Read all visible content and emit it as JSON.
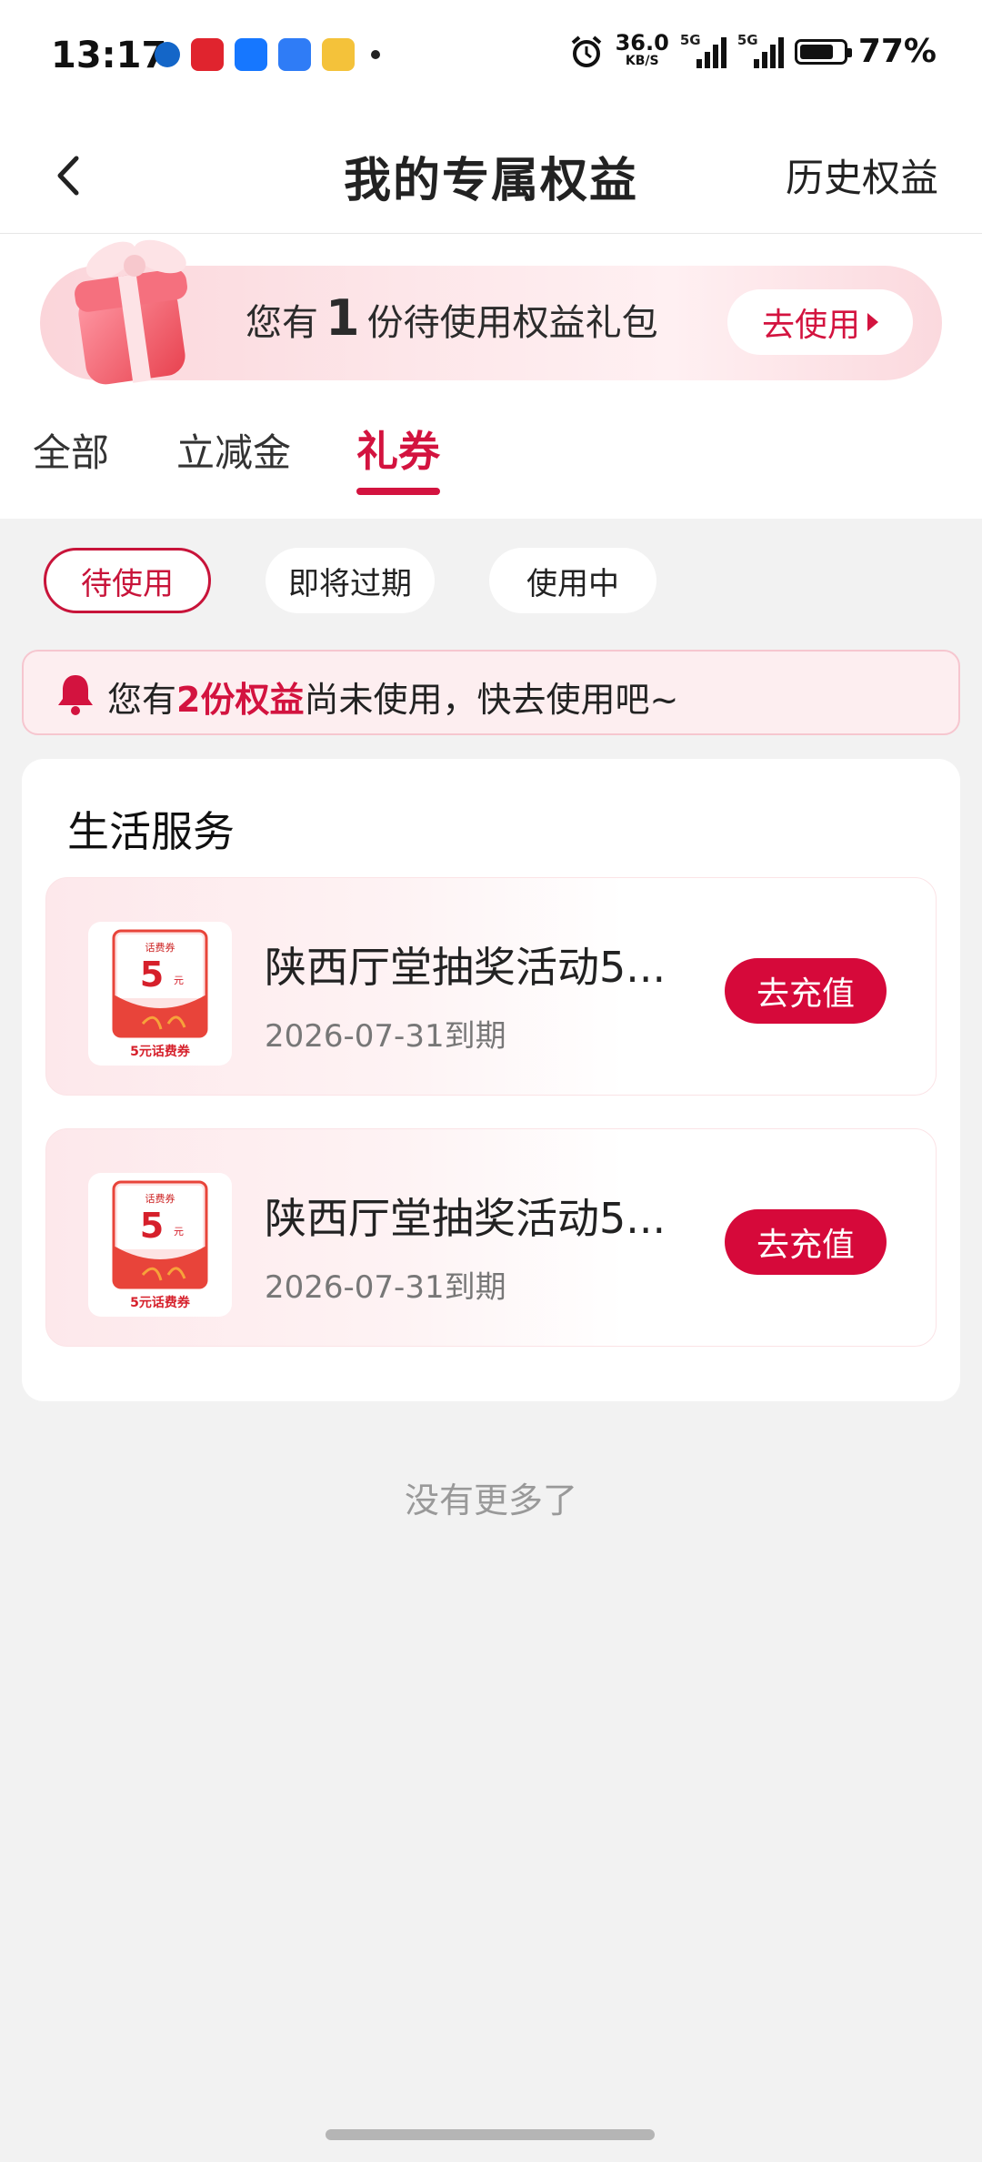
{
  "status_bar": {
    "time": "13:17",
    "net_speed": "36.0",
    "net_unit": "KB/S",
    "sig1": "5G",
    "sig2": "5G",
    "battery": "77%",
    "battery_level": 0.77
  },
  "nav": {
    "title": "我的专属权益",
    "right_link": "历史权益"
  },
  "banner": {
    "prefix": "您有",
    "count": "1",
    "suffix": "份待使用权益礼包",
    "button": "去使用"
  },
  "tabs": [
    {
      "label": "全部"
    },
    {
      "label": "立减金"
    },
    {
      "label": "礼券"
    }
  ],
  "filters": [
    {
      "label": "待使用"
    },
    {
      "label": "即将过期"
    },
    {
      "label": "使用中"
    }
  ],
  "notice": {
    "prefix": "您有",
    "highlight": "2份权益",
    "suffix": "尚未使用，快去使用吧~"
  },
  "section": {
    "title": "生活服务",
    "items": [
      {
        "name": "陕西厅堂抽奖活动5...",
        "expiry": "2026-07-31到期",
        "button": "去充值",
        "thumb": {
          "top": "话费券",
          "amount": "5",
          "unit": "元",
          "caption": "5元话费券"
        }
      },
      {
        "name": "陕西厅堂抽奖活动5...",
        "expiry": "2026-07-31到期",
        "button": "去充值",
        "thumb": {
          "top": "话费券",
          "amount": "5",
          "unit": "元",
          "caption": "5元话费券"
        }
      }
    ]
  },
  "footer": {
    "no_more": "没有更多了"
  },
  "colors": {
    "accent": "#d3133f",
    "button": "#d6093a",
    "background": "#f2f2f2"
  }
}
